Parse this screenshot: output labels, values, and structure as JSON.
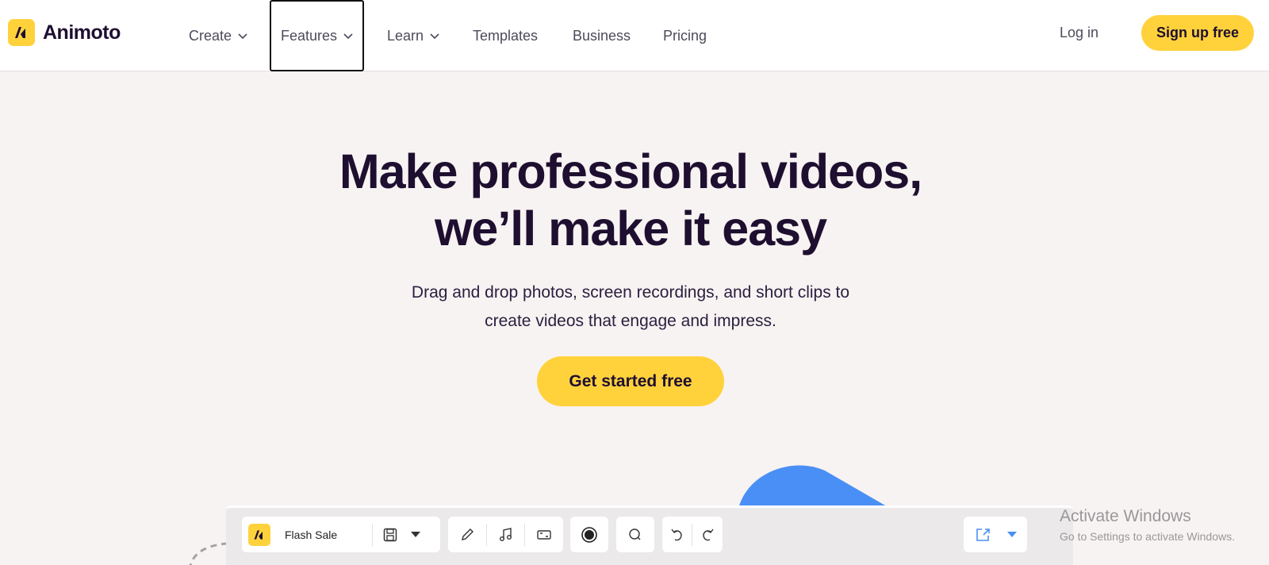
{
  "brand": {
    "name": "Animoto",
    "accent": "#ffd23c",
    "dark": "#1e0f30"
  },
  "nav": {
    "items": [
      {
        "label": "Create",
        "has_dropdown": true
      },
      {
        "label": "Features",
        "has_dropdown": true,
        "focused": true
      },
      {
        "label": "Learn",
        "has_dropdown": true
      },
      {
        "label": "Templates",
        "has_dropdown": false
      },
      {
        "label": "Business",
        "has_dropdown": false
      },
      {
        "label": "Pricing",
        "has_dropdown": false
      }
    ],
    "login": "Log in",
    "signup": "Sign up free"
  },
  "hero": {
    "title_line1": "Make professional videos,",
    "title_line2": "we’ll make it easy",
    "subtitle_line1": "Drag and drop photos, screen recordings, and short clips to",
    "subtitle_line2": "create videos that engage and impress.",
    "cta": "Get started free"
  },
  "editor": {
    "project_name": "Flash Sale",
    "icons": [
      "animoto-logo-icon",
      "save-icon",
      "dropdown-caret-icon",
      "pencil-icon",
      "music-note-icon",
      "aspect-ratio-icon",
      "record-icon",
      "search-icon",
      "undo-icon",
      "redo-icon",
      "share-icon",
      "dropdown-caret-icon"
    ],
    "accent_blue": "#4a8ff5"
  },
  "watermark": {
    "title": "Activate Windows",
    "subtitle": "Go to Settings to activate Windows."
  }
}
